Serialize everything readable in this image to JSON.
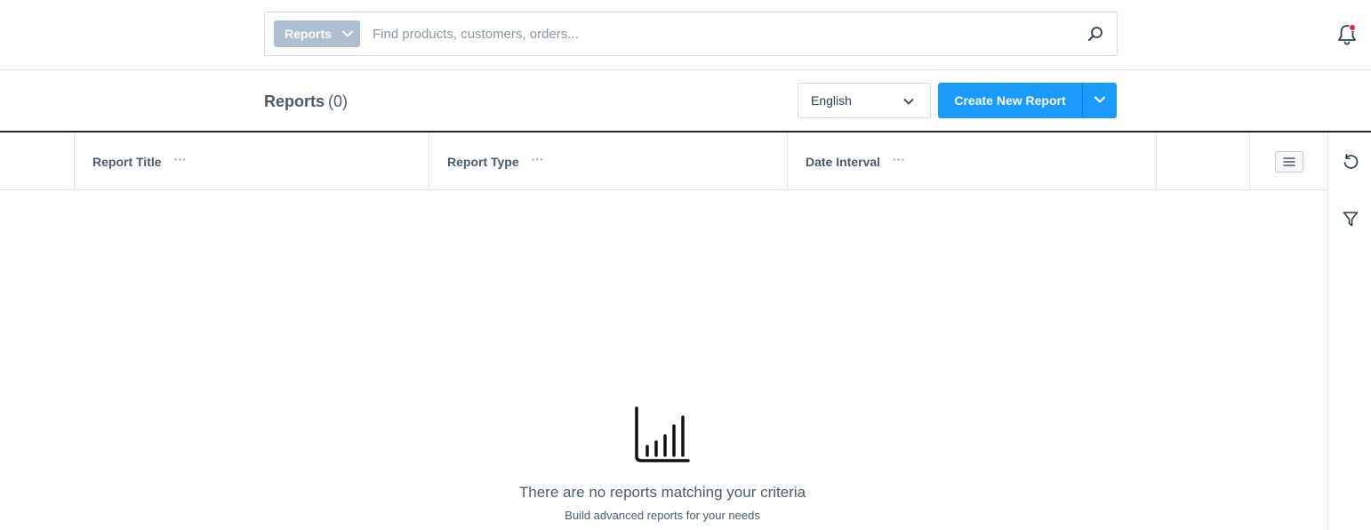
{
  "search": {
    "scope_label": "Reports",
    "placeholder": "Find products, customers, orders..."
  },
  "header": {
    "title": "Reports",
    "count": "(0)",
    "language": "English",
    "create_label": "Create New Report"
  },
  "table": {
    "columns": [
      "Report Title",
      "Report Type",
      "Date Interval"
    ],
    "column_menu": "···"
  },
  "empty_state": {
    "title": "There are no reports matching your criteria",
    "subtitle": "Build advanced reports for your needs"
  },
  "colors": {
    "accent": "#1a9bfc",
    "scope_bg": "#aebfd1",
    "notification_dot": "#e4253c"
  },
  "icons": [
    "chevron-down-icon",
    "search-icon",
    "bell-icon",
    "columns-menu-icon",
    "reset-icon",
    "filter-icon",
    "bar-chart-icon"
  ]
}
